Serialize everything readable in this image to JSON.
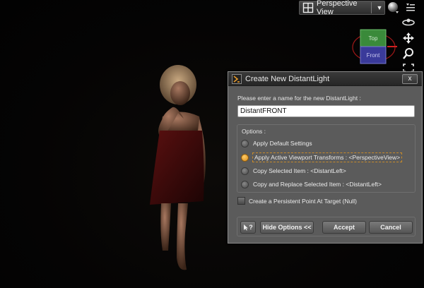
{
  "viewport": {
    "view_select": {
      "label": "Perspective View",
      "icon": "layout-grid-icon"
    }
  },
  "view_cube": {
    "top_label": "Top",
    "front_label": "Front",
    "top_color": "#3a8a3a",
    "front_color": "#3a3a9a"
  },
  "toolbar_icons": [
    "sphere-icon",
    "menu-icon",
    "orbit-icon",
    "move-icon",
    "zoom-icon",
    "frame-icon"
  ],
  "dialog": {
    "title": "Create New DistantLight",
    "close_label": "x",
    "prompt": "Please enter a name for the new DistantLight :",
    "name_value": "DistantFRONT",
    "options_title": "Options :",
    "options": [
      {
        "label": "Apply Default Settings",
        "selected": false
      },
      {
        "label": "Apply Active Viewport Transforms : <PerspectiveView>",
        "selected": true
      },
      {
        "label": "Copy Selected Item : <DistantLeft>",
        "selected": false
      },
      {
        "label": "Copy and Replace Selected Item : <DistantLeft>",
        "selected": false
      }
    ],
    "persistent_point_label": "Create a Persistent Point At Target (Null)",
    "buttons": {
      "help": "?",
      "hide_options": "Hide Options <<",
      "accept": "Accept",
      "cancel": "Cancel"
    }
  },
  "colors": {
    "accent_radio": "#e09a2a",
    "dialog_bg": "#5b5b5b"
  }
}
